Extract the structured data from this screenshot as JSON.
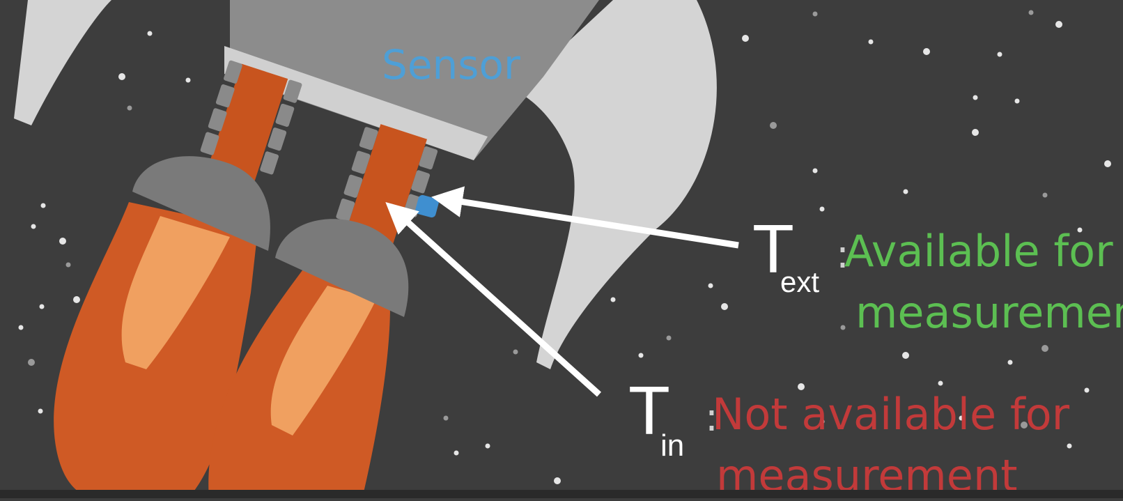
{
  "diagram": {
    "sensor_label": "Sensor",
    "t_ext": {
      "symbol": "T",
      "subscript": "ext",
      "separator": ":",
      "status_line1": "Available for",
      "status_line2": "measurement"
    },
    "t_in": {
      "symbol": "T",
      "subscript": "in",
      "separator": ":",
      "status_line1": "Not available for",
      "status_line2": "measurement"
    }
  },
  "colors": {
    "background": "#3d3d3d",
    "rocket_body": "#8c8c8c",
    "rocket_fin": "#d4d4d4",
    "nozzle_dark": "#7a7a7a",
    "pipe_orange": "#c8541e",
    "flame_outer": "#cf5a25",
    "flame_inner": "#f0a060",
    "sensor_dot": "#3f8fd0",
    "available": "#5cbf52",
    "not_available": "#c23a3a",
    "sensor_text": "#4e9fd6",
    "arrow": "#ffffff"
  }
}
